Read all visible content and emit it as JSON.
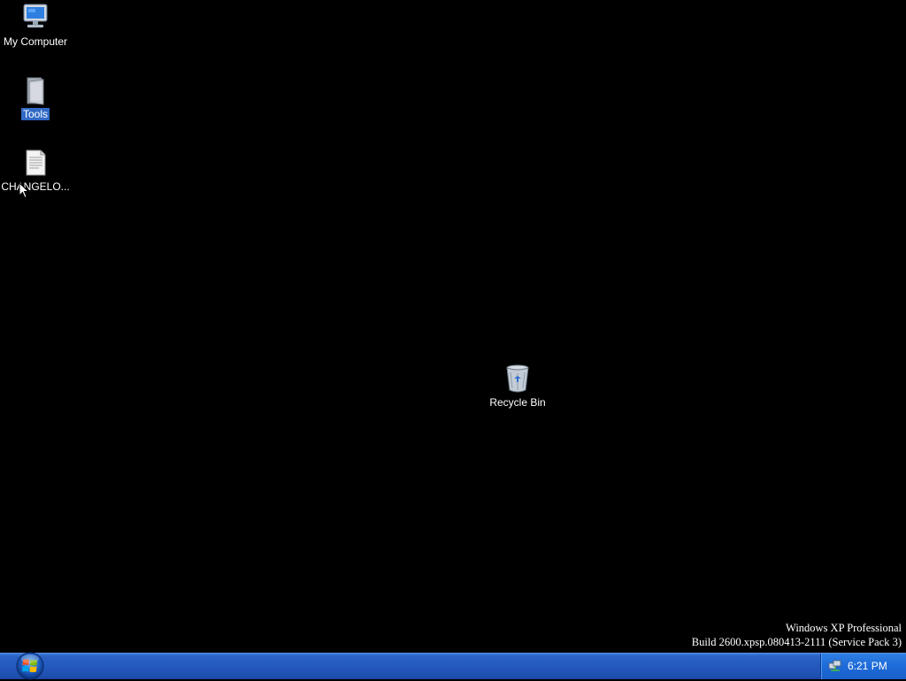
{
  "desktop": {
    "icons": [
      {
        "label": "My Computer",
        "icon": "computer-icon",
        "selected": false
      },
      {
        "label": "Tools",
        "icon": "folder-icon",
        "selected": true
      },
      {
        "label": "CHANGELO...",
        "icon": "text-document-icon",
        "selected": false
      },
      {
        "label": "Recycle Bin",
        "icon": "recycle-bin-icon",
        "selected": false
      }
    ]
  },
  "watermark": {
    "line1": "Windows XP Professional",
    "line2": "Build 2600.xpsp.080413-2111 (Service Pack 3)"
  },
  "taskbar": {
    "start_icon": "windows-orb-icon",
    "tray": {
      "network_icon": "network-icon",
      "clock": "6:21 PM"
    }
  },
  "colors": {
    "desktop_background": "#000000",
    "taskbar_blue": "#2458bd",
    "selection_highlight": "#316ac5"
  }
}
